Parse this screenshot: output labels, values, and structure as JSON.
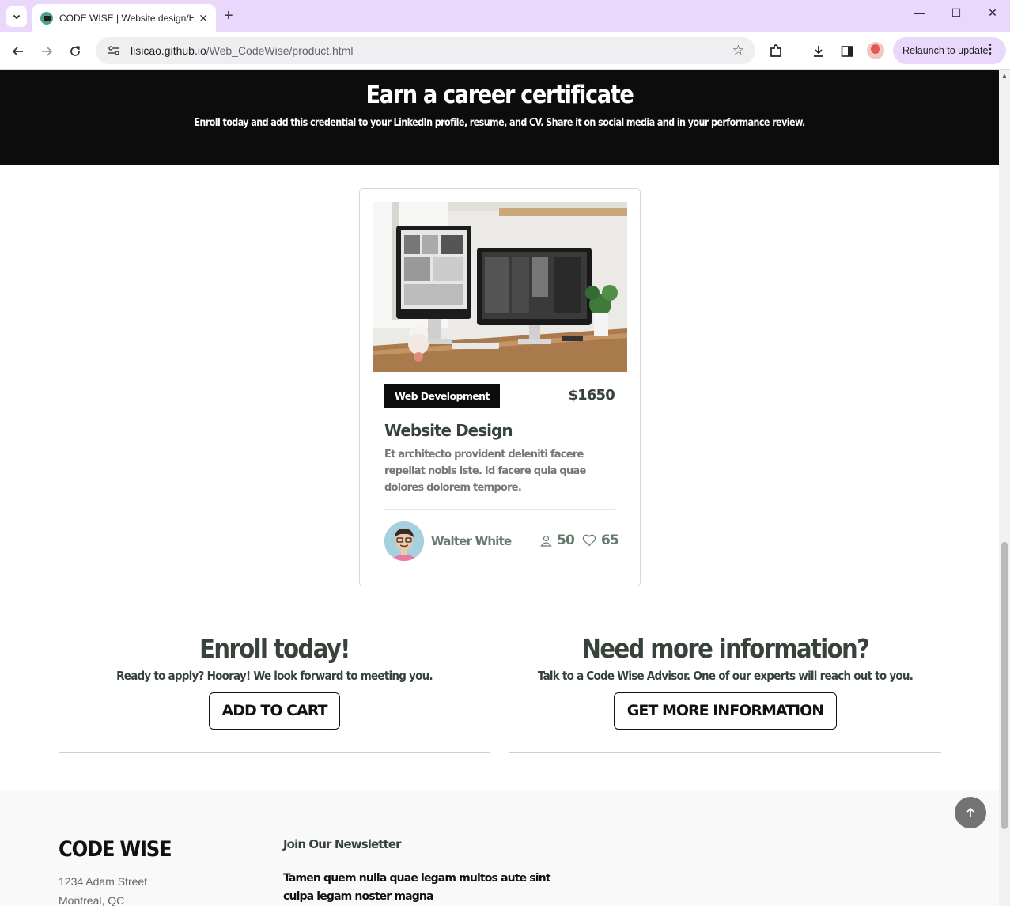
{
  "browser": {
    "tab_title": "CODE WISE | Website design/H",
    "url_host": "lisicao.github.io",
    "url_path": "/Web_CodeWise/product.html",
    "relaunch_label": "Relaunch to update"
  },
  "certificate": {
    "title": "Earn a career certificate",
    "subtitle": "Enroll today and add this credential to your LinkedIn profile, resume, and CV. Share it on social media and in your performance review."
  },
  "course": {
    "category": "Web Development",
    "price": "$1650",
    "title": "Website Design",
    "description": "Et architecto provident deleniti facere repellat nobis iste. Id facere quia quae dolores dolorem tempore.",
    "trainer": "Walter White",
    "students": "50",
    "likes": "65"
  },
  "enroll": {
    "title": "Enroll today!",
    "text": "Ready to apply? Hooray! We look forward to meeting you.",
    "button": "ADD TO CART"
  },
  "info": {
    "title": "Need more information?",
    "text": "Talk to a Code Wise Advisor. One of our experts will reach out to you.",
    "button": "GET MORE INFORMATION"
  },
  "footer": {
    "logo": "CODE WISE",
    "address_line1": "1234 Adam Street",
    "address_line2": "Montreal, QC",
    "newsletter_title": "Join Our Newsletter",
    "newsletter_text": "Tamen quem nulla quae legam multos aute sint culpa legam noster magna"
  },
  "colors": {
    "tabbar": "#e9d8fb",
    "banner": "#0c0c0c",
    "heading": "#37423b",
    "muted": "#657a6d"
  }
}
